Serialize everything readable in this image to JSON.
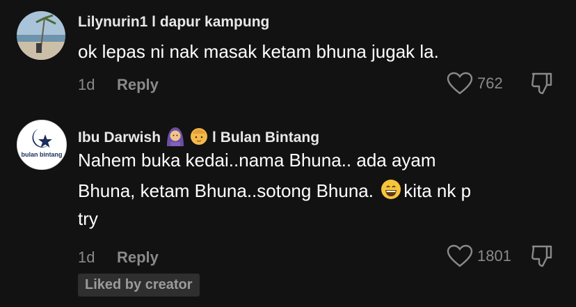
{
  "comments": [
    {
      "username": "Lilynurin1 l dapur kampung",
      "text": "ok lepas ni nak masak ketam bhuna jugak la.",
      "time": "1d",
      "reply_label": "Reply",
      "likes": "762",
      "avatar_icon": "beach-scene-photo"
    },
    {
      "username_pre": "Ibu Darwish",
      "username_post": "l Bulan Bintang",
      "text_line1": "Nahem buka kedai..nama Bhuna.. ada ayam",
      "text_line2a": "Bhuna, ketam Bhuna..sotong Bhuna.",
      "text_line2b": "kita nk p",
      "text_line3": "try",
      "time": "1d",
      "reply_label": "Reply",
      "likes": "1801",
      "badge": "Liked by creator",
      "avatar_logo_text": "bulan bintang",
      "emoji_icons": [
        "woman-with-headscarf-emoji",
        "baby-face-emoji",
        "grinning-face-emoji"
      ]
    }
  ],
  "colors": {
    "background": "#121212",
    "muted": "#8a8a8a"
  }
}
